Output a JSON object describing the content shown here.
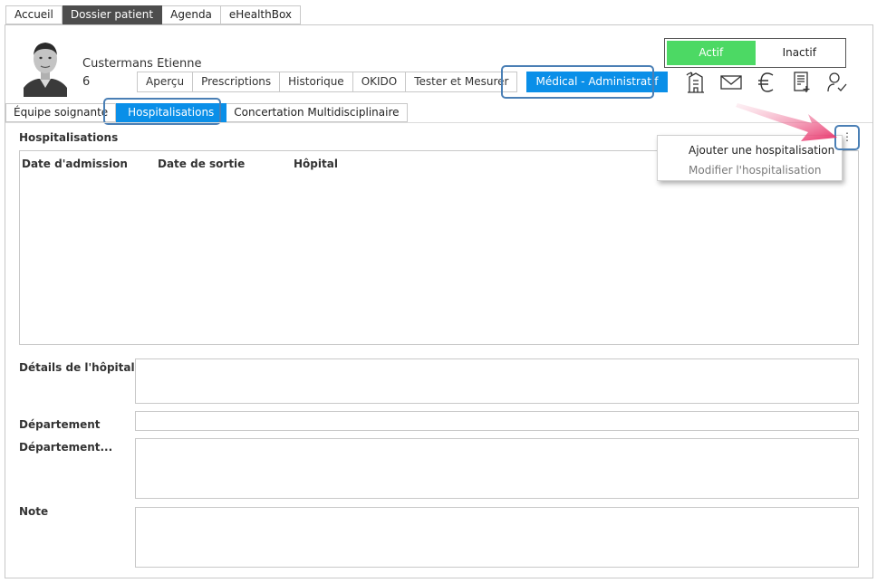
{
  "top_tabs": [
    {
      "label": "Accueil",
      "active": false
    },
    {
      "label": "Dossier patient",
      "active": true
    },
    {
      "label": "Agenda",
      "active": false
    },
    {
      "label": "eHealthBox",
      "active": false
    }
  ],
  "patient": {
    "name": "Custermans Etienne",
    "id": "6"
  },
  "patient_tabs": [
    {
      "label": "Aperçu",
      "active": false
    },
    {
      "label": "Prescriptions",
      "active": false
    },
    {
      "label": "Historique",
      "active": false
    },
    {
      "label": "OKIDO",
      "active": false
    },
    {
      "label": "Tester et Mesurer",
      "active": false
    },
    {
      "label": "Médical - Administratif",
      "active": true
    }
  ],
  "status": {
    "active_label": "Actif",
    "inactive_label": "Inactif",
    "selected": "Actif",
    "active_color": "#4cd964"
  },
  "action_icons": [
    "building-transfer-icon",
    "envelope-icon",
    "euro-icon",
    "document-add-icon",
    "user-check-icon"
  ],
  "section_tabs": [
    {
      "label": "Équipe soignante",
      "active": false
    },
    {
      "label": "Hospitalisations",
      "active": true
    },
    {
      "label": "Concertation Multidisciplinaire",
      "active": false
    }
  ],
  "hospitalisations": {
    "title": "Hospitalisations",
    "more_label": "⋮",
    "columns": [
      "Date d'admission",
      "Date de sortie",
      "Hôpital"
    ],
    "rows": []
  },
  "context_menu": {
    "items": [
      {
        "label": "Ajouter une hospitalisation",
        "enabled": true
      },
      {
        "label": "Modifier l'hospitalisation",
        "enabled": false
      }
    ]
  },
  "form": {
    "hospital_details_label": "Détails de l'hôpital",
    "hospital_details_value": "",
    "department_label": "Département",
    "department_value": "",
    "department_more_label": "Département...",
    "department_more_value": "",
    "note_label": "Note",
    "note_value": ""
  },
  "colors": {
    "accent": "#0a8fe8",
    "dark_tab": "#4d4d4d",
    "highlight": "#4a7fb5",
    "pointer": "#e8336a"
  }
}
